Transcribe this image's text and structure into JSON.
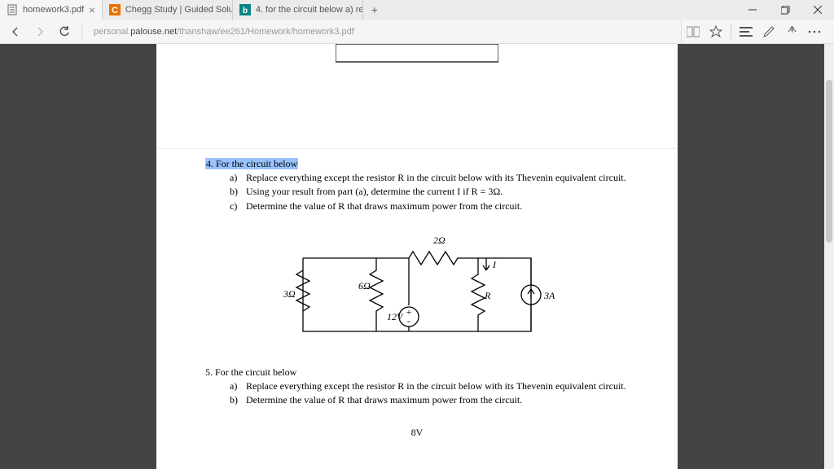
{
  "tabs": [
    {
      "title": "homework3.pdf",
      "icon": "doc",
      "active": true
    },
    {
      "title": "Chegg Study | Guided Solut",
      "icon": "chegg",
      "active": false
    },
    {
      "title": "4. for the circuit below a) re",
      "icon": "bing",
      "active": false
    }
  ],
  "url": {
    "prefix": "personal.",
    "host": "palouse.net",
    "path": "/thanshaw/ee261/Homework/homework3.pdf"
  },
  "q4": {
    "heading": "4.  For the circuit below",
    "a": "Replace everything except the resistor R in the circuit below with its Thevenin equivalent circuit.",
    "b": "Using your result from part (a), determine the current I if R = 3Ω.",
    "c": "Determine the value of R that draws maximum power from the circuit."
  },
  "circuit": {
    "r_top": "2Ω",
    "r_left": "3Ω",
    "r_mid": "6Ω",
    "r_load": "R",
    "v_src": "12V",
    "i_src": "3A",
    "i_label": "I"
  },
  "q5": {
    "heading": "5.   For the circuit below",
    "a": "Replace everything except the resistor R in the circuit below with its Thevenin equivalent circuit.",
    "b": "Determine the value of R that draws maximum power from the circuit."
  },
  "cutoff": "8V"
}
